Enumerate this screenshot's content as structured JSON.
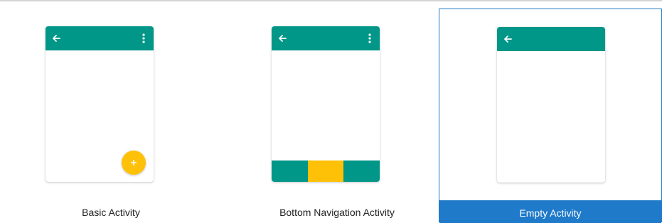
{
  "colors": {
    "primary": "#009688",
    "accent": "#FFC107",
    "selection": "#1F7AC9",
    "label_text": "#222222",
    "selected_label_text": "#FFFFFF"
  },
  "templates": [
    {
      "label": "Basic Activity",
      "icons": [
        "arrow-back-icon",
        "more-vert-icon",
        "fab-add-icon"
      ],
      "selected": false
    },
    {
      "label": "Bottom Navigation Activity",
      "icons": [
        "arrow-back-icon",
        "more-vert-icon",
        "bottom-navigation-bar"
      ],
      "selected": false
    },
    {
      "label": "Empty Activity",
      "icons": [
        "arrow-back-icon"
      ],
      "selected": true
    }
  ]
}
